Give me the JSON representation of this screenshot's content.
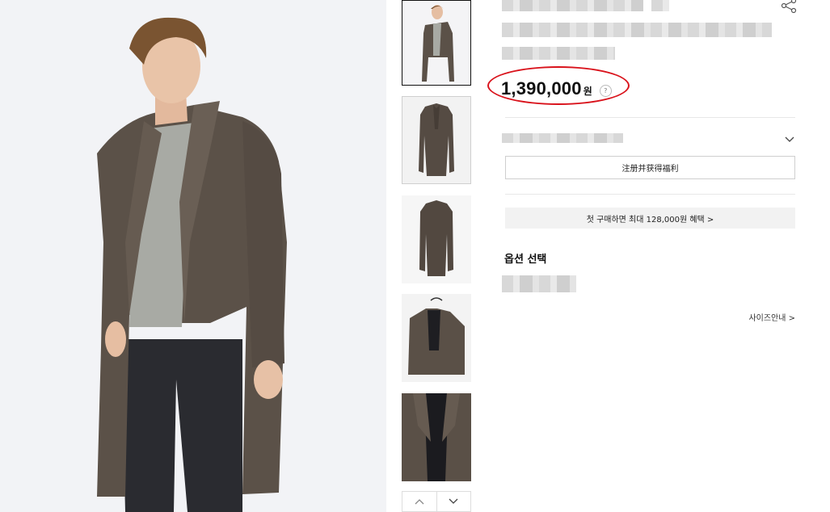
{
  "product": {
    "price": "1,390,000",
    "currency": "원",
    "price_help_icon": "?"
  },
  "benefits": {
    "register_button_label": "注册并获得福利",
    "first_purchase_promo": "첫 구매하면 최대 128,000원 혜택 >"
  },
  "options": {
    "title": "옵션 선택",
    "size_guide_link": "사이즈안내 >"
  },
  "colors": {
    "annotation_circle": "#d9121b",
    "coat": "#5a5047",
    "sweater": "#a9aba5"
  },
  "icons": {
    "share": "share-icon",
    "dropdown": "chevron-down-icon",
    "help": "question-circle-icon",
    "thumb_up": "chevron-up-icon",
    "thumb_down": "chevron-down-icon"
  }
}
